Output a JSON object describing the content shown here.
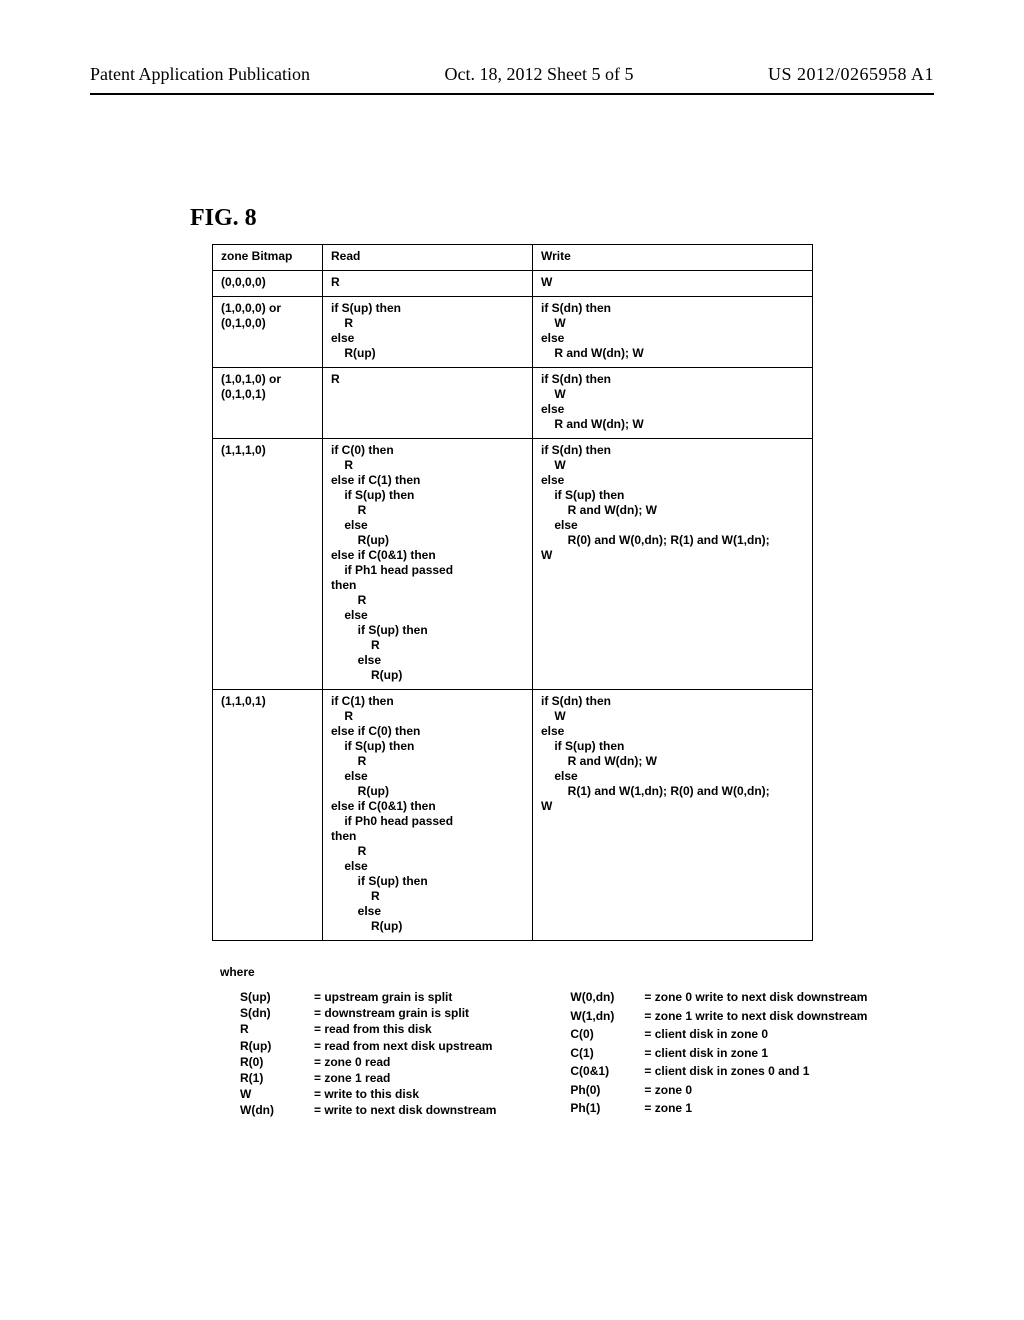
{
  "header": {
    "left": "Patent Application Publication",
    "mid": "Oct. 18, 2012  Sheet 5 of 5",
    "right": "US 2012/0265958 A1"
  },
  "figure_label": "FIG. 8",
  "table": {
    "headers": [
      "zone Bitmap",
      "Read",
      "Write"
    ],
    "rows": [
      {
        "bitmap": "(0,0,0,0)",
        "read": "R",
        "write": "W"
      },
      {
        "bitmap": "(1,0,0,0) or\n(0,1,0,0)",
        "read": "if S(up) then\n    R\nelse\n    R(up)",
        "write": "if S(dn) then\n    W\nelse\n    R and W(dn); W"
      },
      {
        "bitmap": "(1,0,1,0) or\n(0,1,0,1)",
        "read": "R",
        "write": "if S(dn) then\n    W\nelse\n    R and W(dn); W"
      },
      {
        "bitmap": "(1,1,1,0)",
        "read": "if C(0) then\n    R\nelse if C(1) then\n    if S(up) then\n        R\n    else\n        R(up)\nelse if C(0&1) then\n    if Ph1 head passed\nthen\n        R\n    else\n        if S(up) then\n            R\n        else\n            R(up)",
        "write": "if S(dn) then\n    W\nelse\n    if S(up) then\n        R and W(dn); W\n    else\n        R(0) and W(0,dn); R(1) and W(1,dn);\nW"
      },
      {
        "bitmap": "(1,1,0,1)",
        "read": "if C(1) then\n    R\nelse if C(0) then\n    if S(up) then\n        R\n    else\n        R(up)\nelse if C(0&1) then\n    if Ph0 head passed\nthen\n        R\n    else\n        if S(up) then\n            R\n        else\n            R(up)",
        "write": "if S(dn) then\n    W\nelse\n    if S(up) then\n        R and W(dn); W\n    else\n        R(1) and W(1,dn); R(0) and W(0,dn);\nW"
      }
    ]
  },
  "where_label": "where",
  "legend": {
    "left": [
      {
        "sym": "S(up)",
        "def": "= upstream grain is split"
      },
      {
        "sym": "S(dn)",
        "def": "= downstream grain is split"
      },
      {
        "sym": "R",
        "def": "= read from this disk"
      },
      {
        "sym": "R(up)",
        "def": "= read from next disk upstream"
      },
      {
        "sym": "R(0)",
        "def": "= zone 0 read"
      },
      {
        "sym": "R(1)",
        "def": "= zone 1 read"
      },
      {
        "sym": "W",
        "def": "= write to this disk"
      },
      {
        "sym": "W(dn)",
        "def": "= write to next disk downstream"
      }
    ],
    "right": [
      {
        "sym": "W(0,dn)",
        "def": "= zone 0 write to next disk downstream"
      },
      {
        "sym": "W(1,dn)",
        "def": "= zone 1 write to next disk downstream"
      },
      {
        "sym": "C(0)",
        "def": "= client disk in zone 0"
      },
      {
        "sym": "C(1)",
        "def": "= client disk in zone 1"
      },
      {
        "sym": "C(0&1)",
        "def": "= client disk in zones 0 and 1"
      },
      {
        "sym": "Ph(0)",
        "def": "= zone 0"
      },
      {
        "sym": "Ph(1)",
        "def": "= zone 1"
      }
    ]
  }
}
